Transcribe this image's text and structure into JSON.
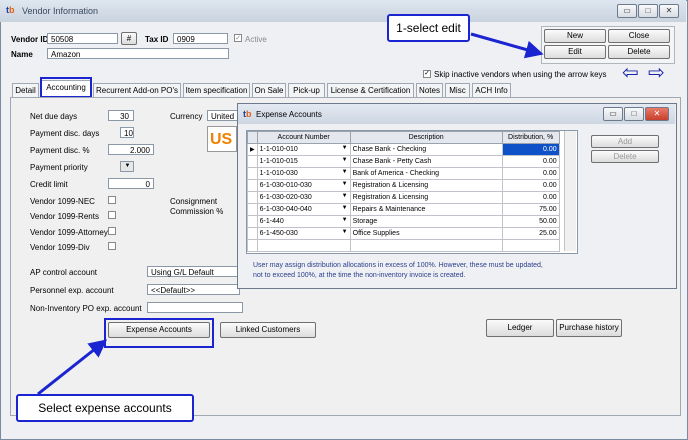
{
  "window": {
    "title": "Vendor Information",
    "logo_t": "t",
    "logo_b": "b",
    "min": "▭",
    "max": "□",
    "close": "✕"
  },
  "vendor": {
    "id_label": "Vendor ID",
    "id_value": "50508",
    "hash_btn": "#",
    "tax_label": "Tax ID",
    "tax_value": "0909",
    "active_label": "Active",
    "active_checked": "✓",
    "name_label": "Name",
    "name_value": "Amazon"
  },
  "actions": {
    "new": "New",
    "close": "Close",
    "edit": "Edit",
    "delete": "Delete"
  },
  "skip_label": "Skip inactive vendors when using the arrow keys",
  "skip_checked": "✓",
  "nav": {
    "prev": "⇦",
    "next": "⇨"
  },
  "tabs": [
    "Detail",
    "Accounting",
    "Recurrent Add-on PO's",
    "Item specification",
    "On Sale",
    "Pick-up",
    "License & Certification",
    "Notes",
    "Misc",
    "ACH Info"
  ],
  "accounting": {
    "net_due_label": "Net due days",
    "net_due_value": "30",
    "disc_days_label": "Payment disc. days",
    "disc_days_value": "10",
    "disc_pct_label": "Payment disc. %",
    "disc_pct_value": "2.000",
    "priority_label": "Payment priority",
    "credit_label": "Credit limit",
    "credit_value": "0",
    "v1099nec": "Vendor 1099-NEC",
    "v1099rents": "Vendor 1099-Rents",
    "v1099att": "Vendor 1099-Attorney",
    "v1099div": "Vendor 1099-Div",
    "currency_label": "Currency",
    "currency_value": "United",
    "currency_badge": "US",
    "consign_label": "Consignment",
    "commission_label": "Commission %",
    "ap_label": "AP control account",
    "ap_value": "Using G/L Default",
    "personnel_label": "Personnel exp. account",
    "personnel_value": "<<Default>>",
    "noninv_label": "Non-Inventory PO exp. account",
    "noninv_value": ""
  },
  "buttons": {
    "expense_accounts": "Expense Accounts",
    "linked_customers": "Linked Customers",
    "ledger": "Ledger",
    "purchase_history": "Purchase history"
  },
  "popup": {
    "title": "Expense Accounts",
    "col_account": "Account Number",
    "col_desc": "Description",
    "col_dist": "Distribution, %",
    "rows": [
      {
        "account": "1-1-010-010",
        "desc": "Chase Bank - Checking",
        "dist": "0.00"
      },
      {
        "account": "1-1-010-015",
        "desc": "Chase Bank - Petty Cash",
        "dist": "0.00"
      },
      {
        "account": "1-1-010-030",
        "desc": "Bank of America - Checking",
        "dist": "0.00"
      },
      {
        "account": "6-1-030-010-030",
        "desc": "Registration & Licensing",
        "dist": "0.00"
      },
      {
        "account": "6-1-030-020-030",
        "desc": "Registration & Licensing",
        "dist": "0.00"
      },
      {
        "account": "6-1-030-040-040",
        "desc": "Repairs & Maintenance",
        "dist": "75.00"
      },
      {
        "account": "6-1-440",
        "desc": "Storage",
        "dist": "50.00"
      },
      {
        "account": "6-1-450-030",
        "desc": "Office Supplies",
        "dist": "25.00"
      }
    ],
    "add": "Add",
    "delete": "Delete",
    "note": "User may assign distribution allocations in excess of 100%.  However, these must be updated, not to exceed 100%, at the time the non-inventory invoice is created."
  },
  "callouts": {
    "select_edit": "1-select edit",
    "select_expense": "Select expense accounts"
  },
  "colors": {
    "annotation": "#1a24d0",
    "selected_cell": "#0f52c8",
    "logo_t": "#1a3ea8",
    "logo_b": "#e06010"
  }
}
